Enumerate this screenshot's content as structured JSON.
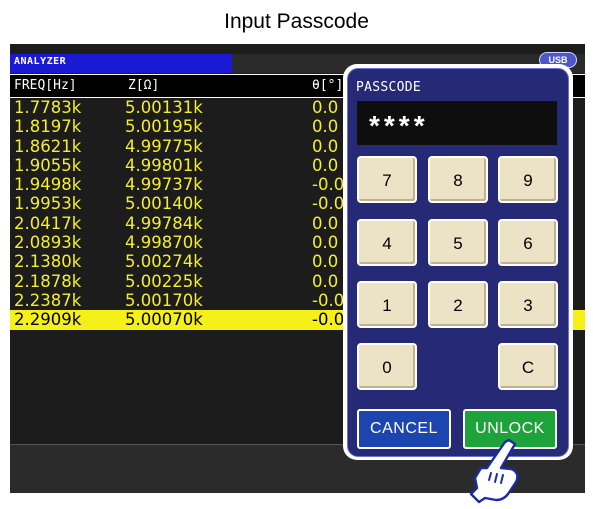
{
  "dialog_title": "Input Passcode",
  "analyzer_label": "ANALYZER",
  "usb_label": "USB",
  "columns": [
    "FREQ[Hz]",
    "Z[Ω]",
    "θ[°]"
  ],
  "rows": [
    {
      "freq": "1.7783k",
      "z": "5.00131k",
      "theta": "0.0"
    },
    {
      "freq": "1.8197k",
      "z": "5.00195k",
      "theta": "0.0"
    },
    {
      "freq": "1.8621k",
      "z": "4.99775k",
      "theta": "0.0"
    },
    {
      "freq": "1.9055k",
      "z": "4.99801k",
      "theta": "0.0"
    },
    {
      "freq": "1.9498k",
      "z": "4.99737k",
      "theta": "-0.0"
    },
    {
      "freq": "1.9953k",
      "z": "5.00140k",
      "theta": "-0.0"
    },
    {
      "freq": "2.0417k",
      "z": "4.99784k",
      "theta": "0.0"
    },
    {
      "freq": "2.0893k",
      "z": "4.99870k",
      "theta": "0.0"
    },
    {
      "freq": "2.1380k",
      "z": "5.00274k",
      "theta": "0.0"
    },
    {
      "freq": "2.1878k",
      "z": "5.00225k",
      "theta": "0.0"
    },
    {
      "freq": "2.2387k",
      "z": "5.00170k",
      "theta": "-0.0"
    },
    {
      "freq": "2.2909k",
      "z": "5.00070k",
      "theta": "-0.0"
    }
  ],
  "selected_row": 11,
  "passcode": {
    "label": "PASSCODE",
    "masked_value": "****",
    "keys": [
      "7",
      "8",
      "9",
      "4",
      "5",
      "6",
      "1",
      "2",
      "3",
      "0",
      "C"
    ],
    "cancel_label": "CANCEL",
    "unlock_label": "UNLOCK"
  },
  "colors": {
    "data_text": "#f4ee2c",
    "selected_row": "#f5f018",
    "dialog_bg": "#262a76",
    "unlock": "#1ea33a",
    "cancel": "#1d45b0"
  }
}
